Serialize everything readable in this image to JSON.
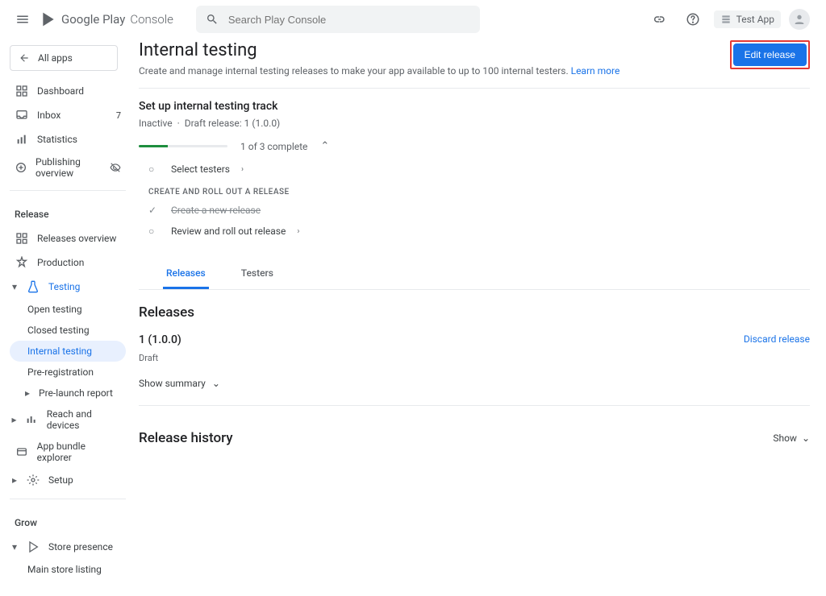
{
  "brand": {
    "t1": "Google Play",
    "t2": "Console"
  },
  "search": {
    "placeholder": "Search Play Console"
  },
  "topright": {
    "app": "Test App"
  },
  "sidebar": {
    "back": "All apps",
    "items": [
      {
        "label": "Dashboard"
      },
      {
        "label": "Inbox",
        "badge": "7"
      },
      {
        "label": "Statistics"
      },
      {
        "label": "Publishing overview"
      }
    ],
    "release_label": "Release",
    "release_items": {
      "overview": "Releases overview",
      "production": "Production",
      "testing": "Testing",
      "open": "Open testing",
      "closed": "Closed testing",
      "internal": "Internal testing",
      "prereg": "Pre-registration",
      "prelaunch": "Pre-launch report",
      "reach": "Reach and devices",
      "bundle": "App bundle explorer",
      "setup": "Setup"
    },
    "grow_label": "Grow",
    "grow_items": {
      "store": "Store presence",
      "main_listing": "Main store listing"
    }
  },
  "page": {
    "title": "Internal testing",
    "desc": "Create and manage internal testing releases to make your app available to up to 100 internal testers.",
    "learn": "Learn more",
    "edit_btn": "Edit release"
  },
  "track": {
    "header": "Set up internal testing track",
    "status1": "Inactive",
    "status2": "Draft release: 1 (1.0.0)",
    "progress_text": "1 of 3 complete",
    "step1": "Select testers",
    "subhead": "CREATE AND ROLL OUT A RELEASE",
    "step2": "Create a new release",
    "step3": "Review and roll out release"
  },
  "tabs": {
    "releases": "Releases",
    "testers": "Testers"
  },
  "releases": {
    "header": "Releases",
    "name": "1 (1.0.0)",
    "sub": "Draft",
    "discard": "Discard release",
    "show_summary": "Show summary"
  },
  "history": {
    "header": "Release history",
    "show": "Show"
  }
}
